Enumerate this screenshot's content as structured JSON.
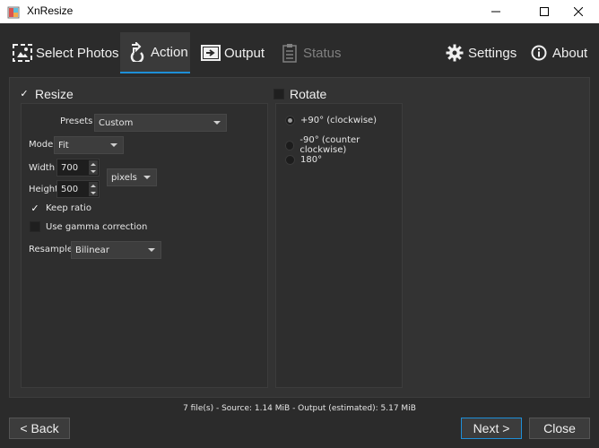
{
  "window": {
    "title": "XnResize"
  },
  "toolbar": {
    "tabs": [
      {
        "label": "Select Photos",
        "icon": "select-photos-icon"
      },
      {
        "label": "Action",
        "icon": "action-icon"
      },
      {
        "label": "Output",
        "icon": "output-icon"
      },
      {
        "label": "Status",
        "icon": "status-icon"
      }
    ],
    "settings_label": "Settings",
    "about_label": "About",
    "accent": "#1e8fd8"
  },
  "resize": {
    "label": "Resize",
    "checked": true,
    "presets_label": "Presets",
    "presets_value": "Custom",
    "mode_label": "Mode",
    "mode_value": "Fit",
    "width_label": "Width",
    "width_value": "700",
    "height_label": "Height",
    "height_value": "500",
    "unit_value": "pixels",
    "keep_ratio_label": "Keep ratio",
    "keep_ratio_checked": true,
    "gamma_label": "Use gamma correction",
    "gamma_checked": false,
    "resample_label": "Resample",
    "resample_value": "Bilinear"
  },
  "rotate": {
    "label": "Rotate",
    "checked": false,
    "options": [
      {
        "label": "+90° (clockwise)",
        "selected": true
      },
      {
        "label": "-90° (counter clockwise)",
        "selected": false
      },
      {
        "label": "180°",
        "selected": false
      }
    ]
  },
  "status": {
    "text": "7 file(s) - Source: 1.14 MiB - Output (estimated): 5.17 MiB"
  },
  "footer": {
    "back_label": "< Back",
    "next_label": "Next >",
    "close_label": "Close"
  }
}
